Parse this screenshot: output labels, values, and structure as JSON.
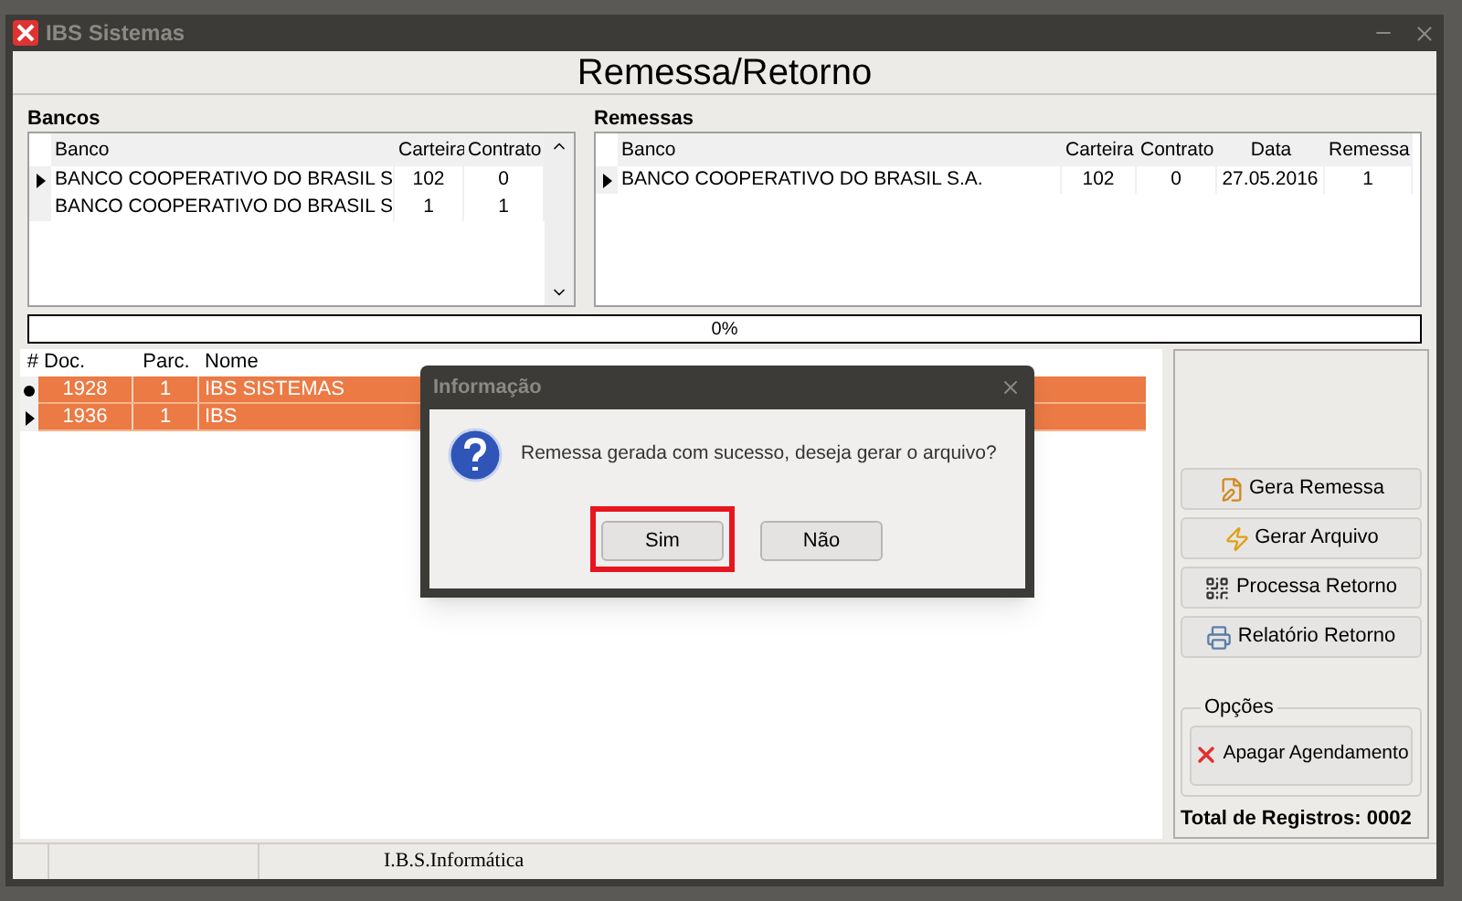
{
  "window": {
    "title": "IBS Sistemas"
  },
  "header": "Remessa/Retorno",
  "bancos": {
    "label": "Bancos",
    "columns": [
      "Banco",
      "Carteira",
      "Contrato"
    ],
    "rows": [
      {
        "cells": [
          "BANCO COOPERATIVO DO BRASIL S",
          "102",
          "0"
        ],
        "selected": true
      },
      {
        "cells": [
          "BANCO COOPERATIVO DO BRASIL S",
          "1",
          "1"
        ],
        "selected": false
      }
    ]
  },
  "remessas": {
    "label": "Remessas",
    "columns": [
      "Banco",
      "Carteira",
      "Contrato",
      "Data",
      "Remessa"
    ],
    "rows": [
      {
        "cells": [
          "BANCO COOPERATIVO DO BRASIL S.A.",
          "102",
          "0",
          "27.05.2016",
          "1"
        ],
        "selected": true
      }
    ]
  },
  "progress": {
    "level": 0,
    "reading": "0%"
  },
  "documents": {
    "marker_header": "#",
    "columns": [
      "Doc.",
      "Parc.",
      "Nome"
    ],
    "rows": [
      {
        "kind": "editing",
        "cells": [
          "1928",
          "1",
          "IBS SISTEMAS"
        ],
        "highlighted": true
      },
      {
        "kind": "current",
        "cells": [
          "1936",
          "1",
          "IBS"
        ],
        "highlighted": true
      }
    ]
  },
  "actions": [
    {
      "label": "Gera Remessa"
    },
    {
      "label": "Gerar Arquivo"
    },
    {
      "label": "Processa Retorno"
    },
    {
      "label": "Relatório Retorno"
    }
  ],
  "options": {
    "label": "Opções",
    "button": "Apagar Agendamento"
  },
  "total": "Total de Registros: 0002",
  "status_bar": {
    "text": "I.B.S.Informática"
  },
  "dialog": {
    "title": "Informação",
    "message": "Remessa gerada com sucesso, deseja gerar o arquivo?",
    "buttons": [
      {
        "label": "Sim",
        "highlighted": true
      },
      {
        "label": "Não",
        "highlighted": false
      }
    ]
  }
}
